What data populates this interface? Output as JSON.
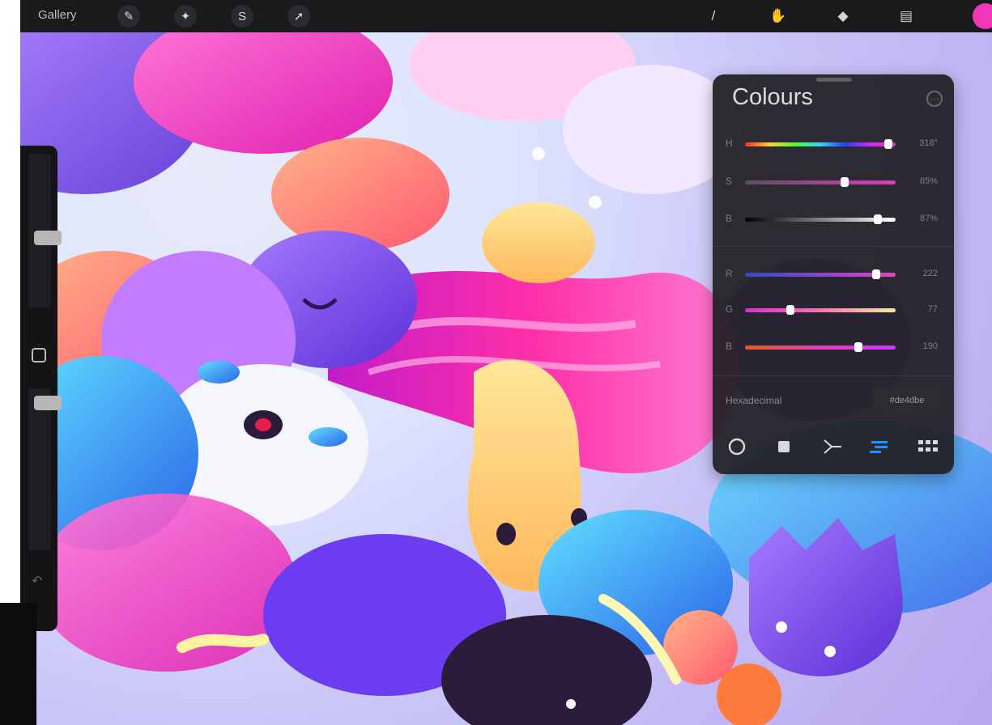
{
  "topbar": {
    "gallery_label": "Gallery",
    "action_icons": [
      "wrench-icon",
      "magic-wand-icon",
      "selection-icon",
      "transform-arrow-icon"
    ],
    "tool_icons": [
      "brush-icon",
      "smudge-icon",
      "eraser-icon",
      "layers-icon"
    ],
    "current_colour": "#f236b8"
  },
  "sidebar": {
    "size_slider_level": 0.45,
    "opacity_slider_level": 0.95
  },
  "colour_panel": {
    "title": "Colours",
    "hsb": [
      {
        "label": "H",
        "value": "318°",
        "position": 0.95
      },
      {
        "label": "S",
        "value": "85%",
        "position": 0.66
      },
      {
        "label": "B",
        "value": "87%",
        "position": 0.88
      }
    ],
    "rgb": [
      {
        "label": "R",
        "value": "222",
        "position": 0.87
      },
      {
        "label": "G",
        "value": "77",
        "position": 0.3
      },
      {
        "label": "B",
        "value": "190",
        "position": 0.75
      }
    ],
    "hex_label": "Hexadecimal",
    "hex_value": "#de4dbe",
    "modes": [
      {
        "icon": "disc-icon",
        "active": false
      },
      {
        "icon": "classic-square-icon",
        "active": false
      },
      {
        "icon": "harmony-icon",
        "active": false
      },
      {
        "icon": "value-sliders-icon",
        "active": true
      },
      {
        "icon": "palettes-grid-icon",
        "active": false
      }
    ]
  }
}
